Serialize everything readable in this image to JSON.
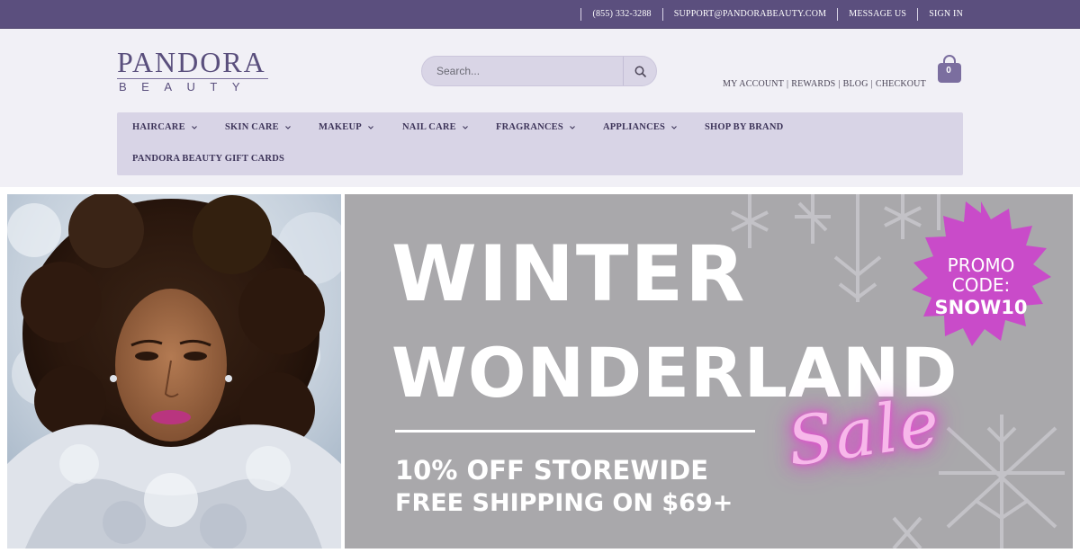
{
  "topbar": {
    "phone": "(855) 332-3288",
    "email": "SUPPORT@PANDORABEAUTY.COM",
    "message": "MESSAGE US",
    "signin": "SIGN IN"
  },
  "logo": {
    "main": "PANDORA",
    "sub": "BEAUTY"
  },
  "search": {
    "placeholder": "Search..."
  },
  "account_links": [
    "MY ACCOUNT",
    "REWARDS",
    "BLOG",
    "CHECKOUT"
  ],
  "cart": {
    "count": "0"
  },
  "nav": {
    "haircare": "HAIRCARE",
    "skincare": "SKIN CARE",
    "makeup": "MAKEUP",
    "nailcare": "NAIL CARE",
    "fragrances": "FRAGRANCES",
    "appliances": "APPLIANCES",
    "shop_by_brand": "SHOP BY BRAND",
    "gift_cards": "PANDORA BEAUTY GIFT CARDS"
  },
  "banner": {
    "title_line1": "WINTER",
    "title_line2": "WONDERLAND",
    "sale": "Sale",
    "offer1": "10% OFF STOREWIDE",
    "offer2": "FREE SHIPPING ON $69+",
    "promo_line1": "PROMO",
    "promo_line2": "CODE:",
    "promo_code": "SNOW10"
  },
  "colors": {
    "brand_purple": "#5b4f7e",
    "nav_background": "#d8d4e6",
    "promo_magenta": "#c94bc9",
    "neon_pink": "#f7b8ea"
  }
}
